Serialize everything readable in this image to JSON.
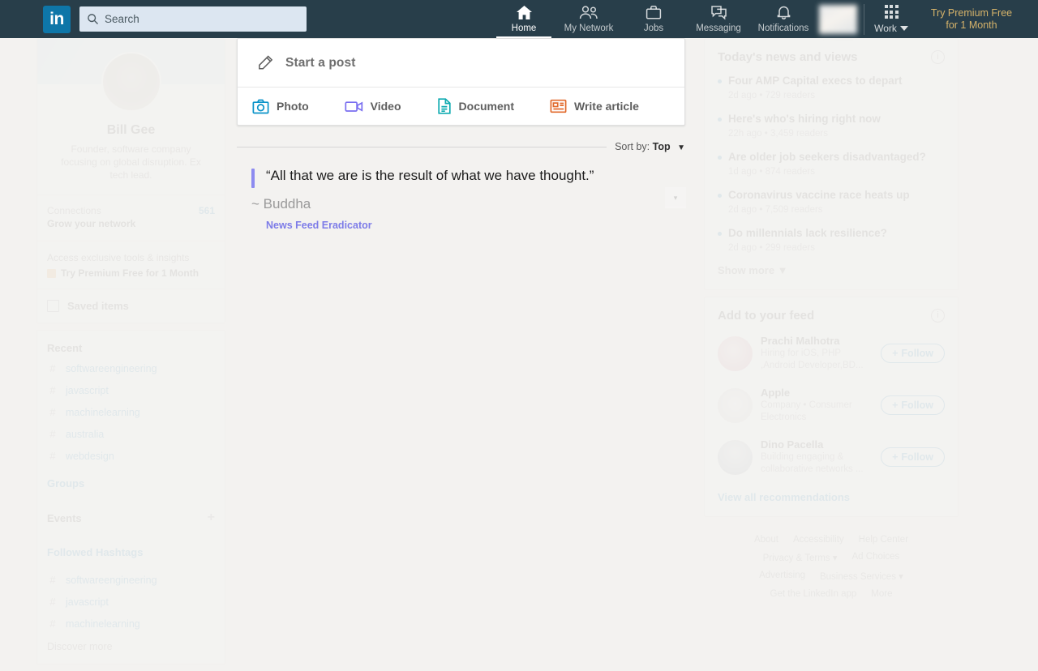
{
  "nav": {
    "logo_text": "in",
    "search_placeholder": "Search",
    "items": [
      {
        "label": "Home",
        "icon": "home-icon",
        "active": true
      },
      {
        "label": "My Network",
        "icon": "people-icon",
        "active": false
      },
      {
        "label": "Jobs",
        "icon": "briefcase-icon",
        "active": false
      },
      {
        "label": "Messaging",
        "icon": "message-icon",
        "active": false
      },
      {
        "label": "Notifications",
        "icon": "bell-icon",
        "active": false
      }
    ],
    "work_label": "Work",
    "premium_line1": "Try Premium Free",
    "premium_line2": "for 1 Month",
    "bg_color": "#283e4a",
    "logo_color": "#0e76a8",
    "premium_color": "#d6b36a"
  },
  "left": {
    "profile": {
      "name": "Bill Gee",
      "headline": "Founder, software company focusing on global disruption. Ex tech lead."
    },
    "connections": {
      "label": "Connections",
      "count": "561",
      "subtitle": "Grow your network"
    },
    "promo": {
      "text": "Access exclusive tools & insights",
      "cta": "Try Premium Free for 1 Month"
    },
    "saved_items": "Saved items",
    "recent_title": "Recent",
    "recent_tags": [
      "softwareengineering",
      "javascript",
      "machinelearning",
      "australia",
      "webdesign"
    ],
    "groups_label": "Groups",
    "events_label": "Events",
    "hashtags_label": "Followed Hashtags",
    "followed_tags": [
      "softwareengineering",
      "javascript",
      "machinelearning"
    ],
    "discover_more": "Discover more"
  },
  "center": {
    "start_post_label": "Start a post",
    "actions": [
      {
        "label": "Photo",
        "icon": "photo-icon",
        "color": "#0a93c9"
      },
      {
        "label": "Video",
        "icon": "video-icon",
        "color": "#7a6ff0"
      },
      {
        "label": "Document",
        "icon": "document-icon",
        "color": "#0eaab0"
      },
      {
        "label": "Write article",
        "icon": "article-icon",
        "color": "#e16a2c"
      }
    ],
    "sort_prefix": "Sort by:",
    "sort_value": "Top",
    "quote": {
      "text": "“All that we are is the result of what we have thought.”",
      "author": "~ Buddha",
      "brand": "News Feed Eradicator",
      "bar_color": "#8d8bf0",
      "brand_color": "#7d7ce8"
    }
  },
  "right": {
    "news_title": "Today's news and views",
    "news": [
      {
        "headline": "Four AMP Capital execs to depart",
        "meta": "2d ago • 729 readers"
      },
      {
        "headline": "Here's who's hiring right now",
        "meta": "22h ago • 3,459 readers"
      },
      {
        "headline": "Are older job seekers disadvantaged?",
        "meta": "1d ago • 874 readers"
      },
      {
        "headline": "Coronavirus vaccine race heats up",
        "meta": "2d ago • 7,509 readers"
      },
      {
        "headline": "Do millennials lack resilience?",
        "meta": "2d ago • 299 readers"
      }
    ],
    "show_more": "Show more ▼",
    "feed_title": "Add to your feed",
    "feed": [
      {
        "name": "Prachi Malhotra",
        "sub": "Hiring for iOS, PHP ,Android Developer,BD...",
        "follow": "Follow"
      },
      {
        "name": "Apple",
        "sub": "Company • Consumer Electronics",
        "follow": "Follow"
      },
      {
        "name": "Dino Pacella",
        "sub": "Building engaging & collaborative networks ...",
        "follow": "Follow"
      }
    ],
    "view_all": "View all recommendations",
    "footer": [
      [
        "About",
        "Accessibility",
        "Help Center"
      ],
      [
        "Privacy & Terms ▾",
        "Ad Choices"
      ],
      [
        "Advertising",
        "Business Services ▾"
      ],
      [
        "Get the LinkedIn app",
        "More"
      ]
    ]
  }
}
